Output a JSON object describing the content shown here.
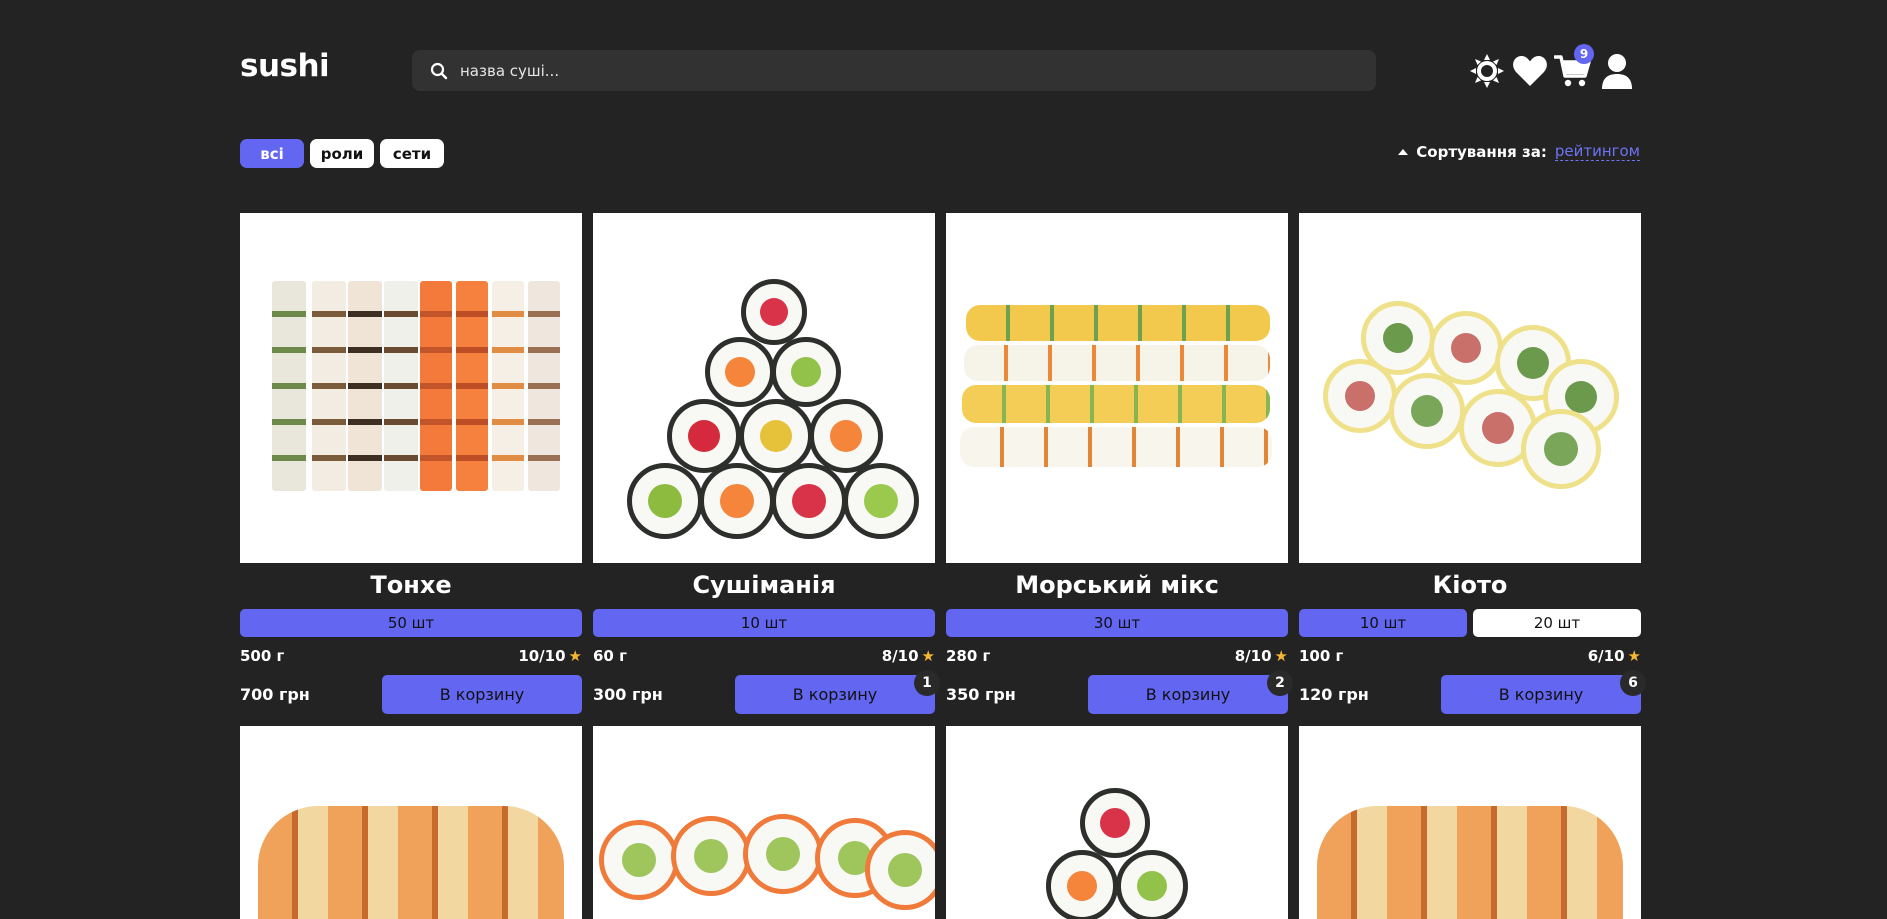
{
  "header": {
    "logo": "sushi",
    "search_placeholder": "назва суші...",
    "cart_count": "9"
  },
  "filters": [
    {
      "label": "всі",
      "active": true
    },
    {
      "label": "роли",
      "active": false
    },
    {
      "label": "сети",
      "active": false
    }
  ],
  "sort": {
    "label": "Сортування за:",
    "value": "рейтингом"
  },
  "colors": {
    "accent": "#6366f1",
    "background": "#232323",
    "star": "#f5b731"
  },
  "products": [
    {
      "name": "Тонхе",
      "sizes": [
        "50 шт"
      ],
      "weight": "500 г",
      "rating": "10/10",
      "price": "700 грн",
      "button": "В корзину",
      "in_cart": ""
    },
    {
      "name": "Сушіманія",
      "sizes": [
        "10 шт"
      ],
      "weight": "60 г",
      "rating": "8/10",
      "price": "300 грн",
      "button": "В корзину",
      "in_cart": "1"
    },
    {
      "name": "Морський мікс",
      "sizes": [
        "30 шт"
      ],
      "weight": "280 г",
      "rating": "8/10",
      "price": "350 грн",
      "button": "В корзину",
      "in_cart": "2"
    },
    {
      "name": "Кіото",
      "sizes": [
        "10 шт",
        "20 шт"
      ],
      "weight": "100 г",
      "rating": "6/10",
      "price": "120 грн",
      "button": "В корзину",
      "in_cart": "6"
    }
  ]
}
